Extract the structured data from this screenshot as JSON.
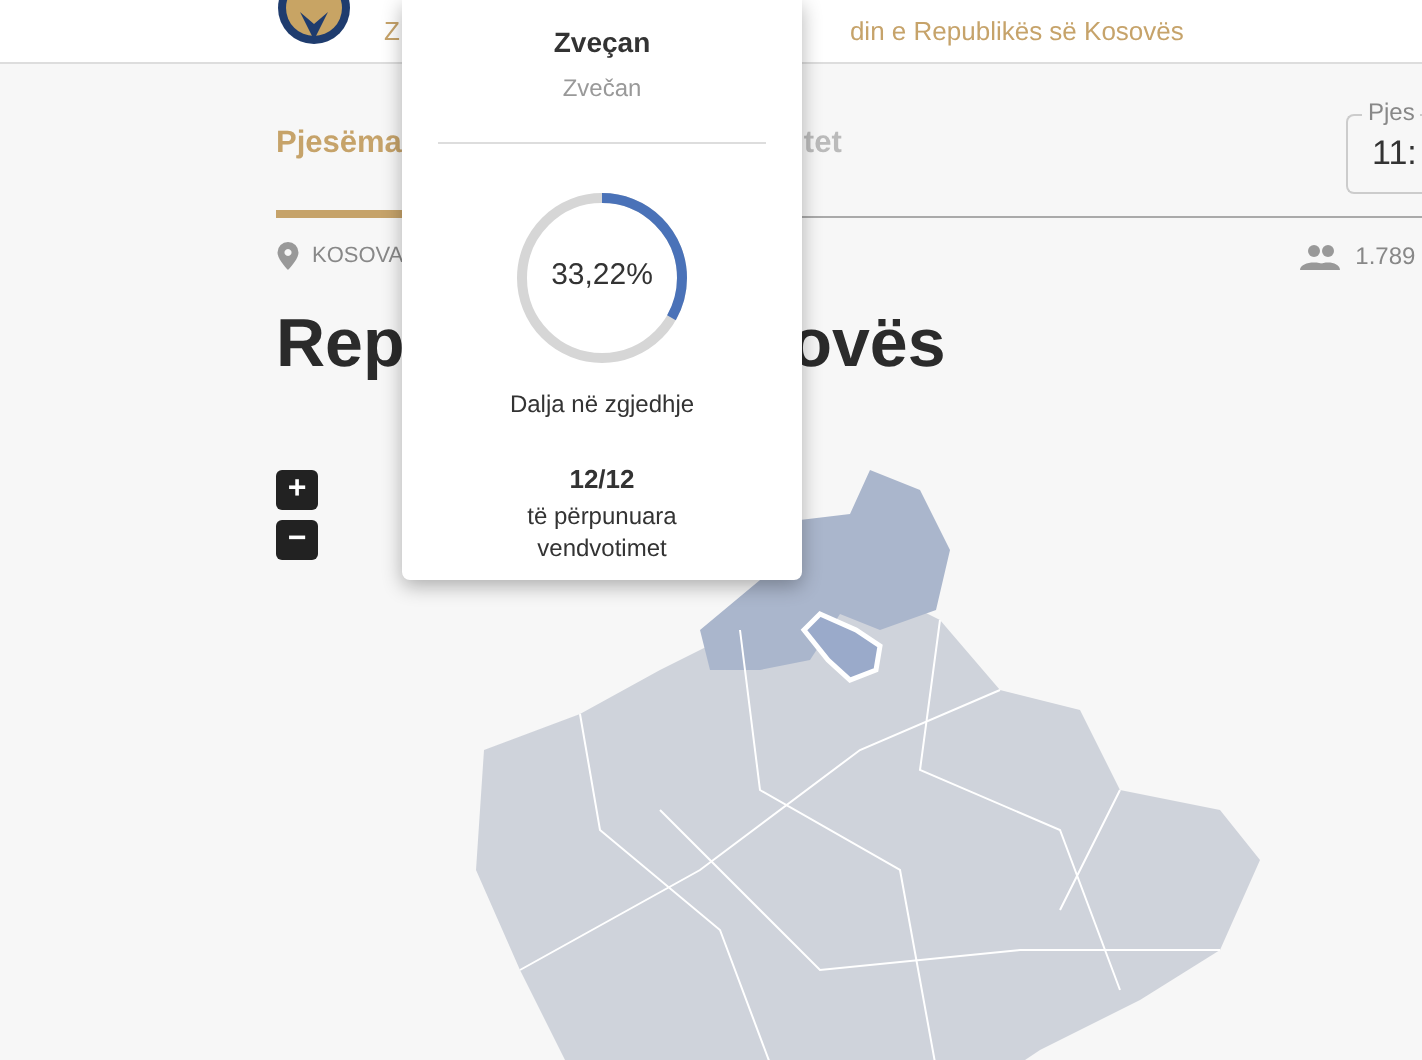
{
  "header": {
    "title_start": "Z",
    "title_end": "din e Republikës së Kosovës"
  },
  "tabs": [
    {
      "label": "Pjesëma",
      "selected": true
    },
    {
      "label": "tet",
      "selected": false
    }
  ],
  "time_field": {
    "label": "Pjes",
    "value": "11:"
  },
  "location": {
    "place": "KOSOVA",
    "voters": "1.789"
  },
  "heading": {
    "start": "Rep",
    "end": "ovës"
  },
  "zoom_controls": [
    "+",
    "−"
  ],
  "popup": {
    "name": "Zveçan",
    "alt_name": "Zvečan",
    "turnout": {
      "level": 0.3322,
      "reading": "33,22%",
      "caption": "Dalja në zgjedhje"
    },
    "stations": {
      "count": "12/12",
      "caption": "të përpunuara vendvotimet"
    }
  }
}
